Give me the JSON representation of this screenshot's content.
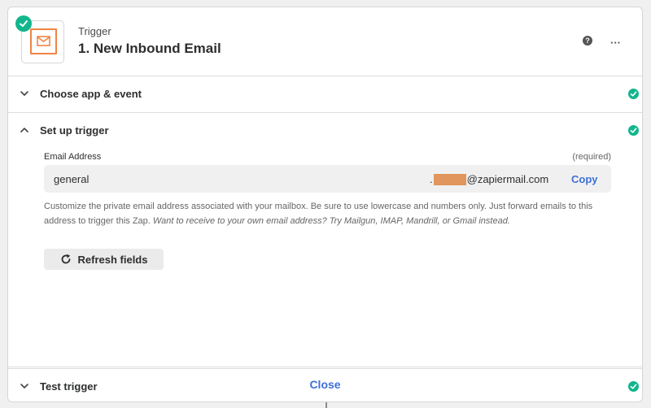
{
  "header": {
    "kind_label": "Trigger",
    "title": "1. New Inbound Email",
    "help_symbol": "?",
    "more_symbol": "···"
  },
  "sections": {
    "choose_app": {
      "title": "Choose app & event",
      "complete": true
    },
    "setup": {
      "title": "Set up trigger",
      "complete": true
    },
    "test": {
      "title": "Test trigger",
      "complete": true
    }
  },
  "setup_form": {
    "email_label": "Email Address",
    "required_label": "(required)",
    "email_prefix": "general",
    "email_dot": ".",
    "email_domain": "@zapiermail.com",
    "copy_label": "Copy",
    "help_text_plain": "Customize the private email address associated with your mailbox. Be sure to use lowercase and numbers only. Just forward emails to this address to trigger this Zap. ",
    "help_text_italic": "Want to receive to your own email address? Try Mailgun, IMAP, Mandrill, or Gmail instead.",
    "refresh_label": "Refresh fields"
  },
  "footer": {
    "close_label": "Close"
  },
  "colors": {
    "success": "#13b58c",
    "link": "#3e6fd9",
    "app_icon": "#f08445",
    "redaction": "#e0965c"
  },
  "icons": {
    "app": "email-envelope-icon",
    "status": "check-circle-icon",
    "help": "question-circle-icon",
    "more": "more-horizontal-icon",
    "collapse": "chevron-down-icon",
    "expand": "chevron-up-icon",
    "refresh": "refresh-icon"
  }
}
